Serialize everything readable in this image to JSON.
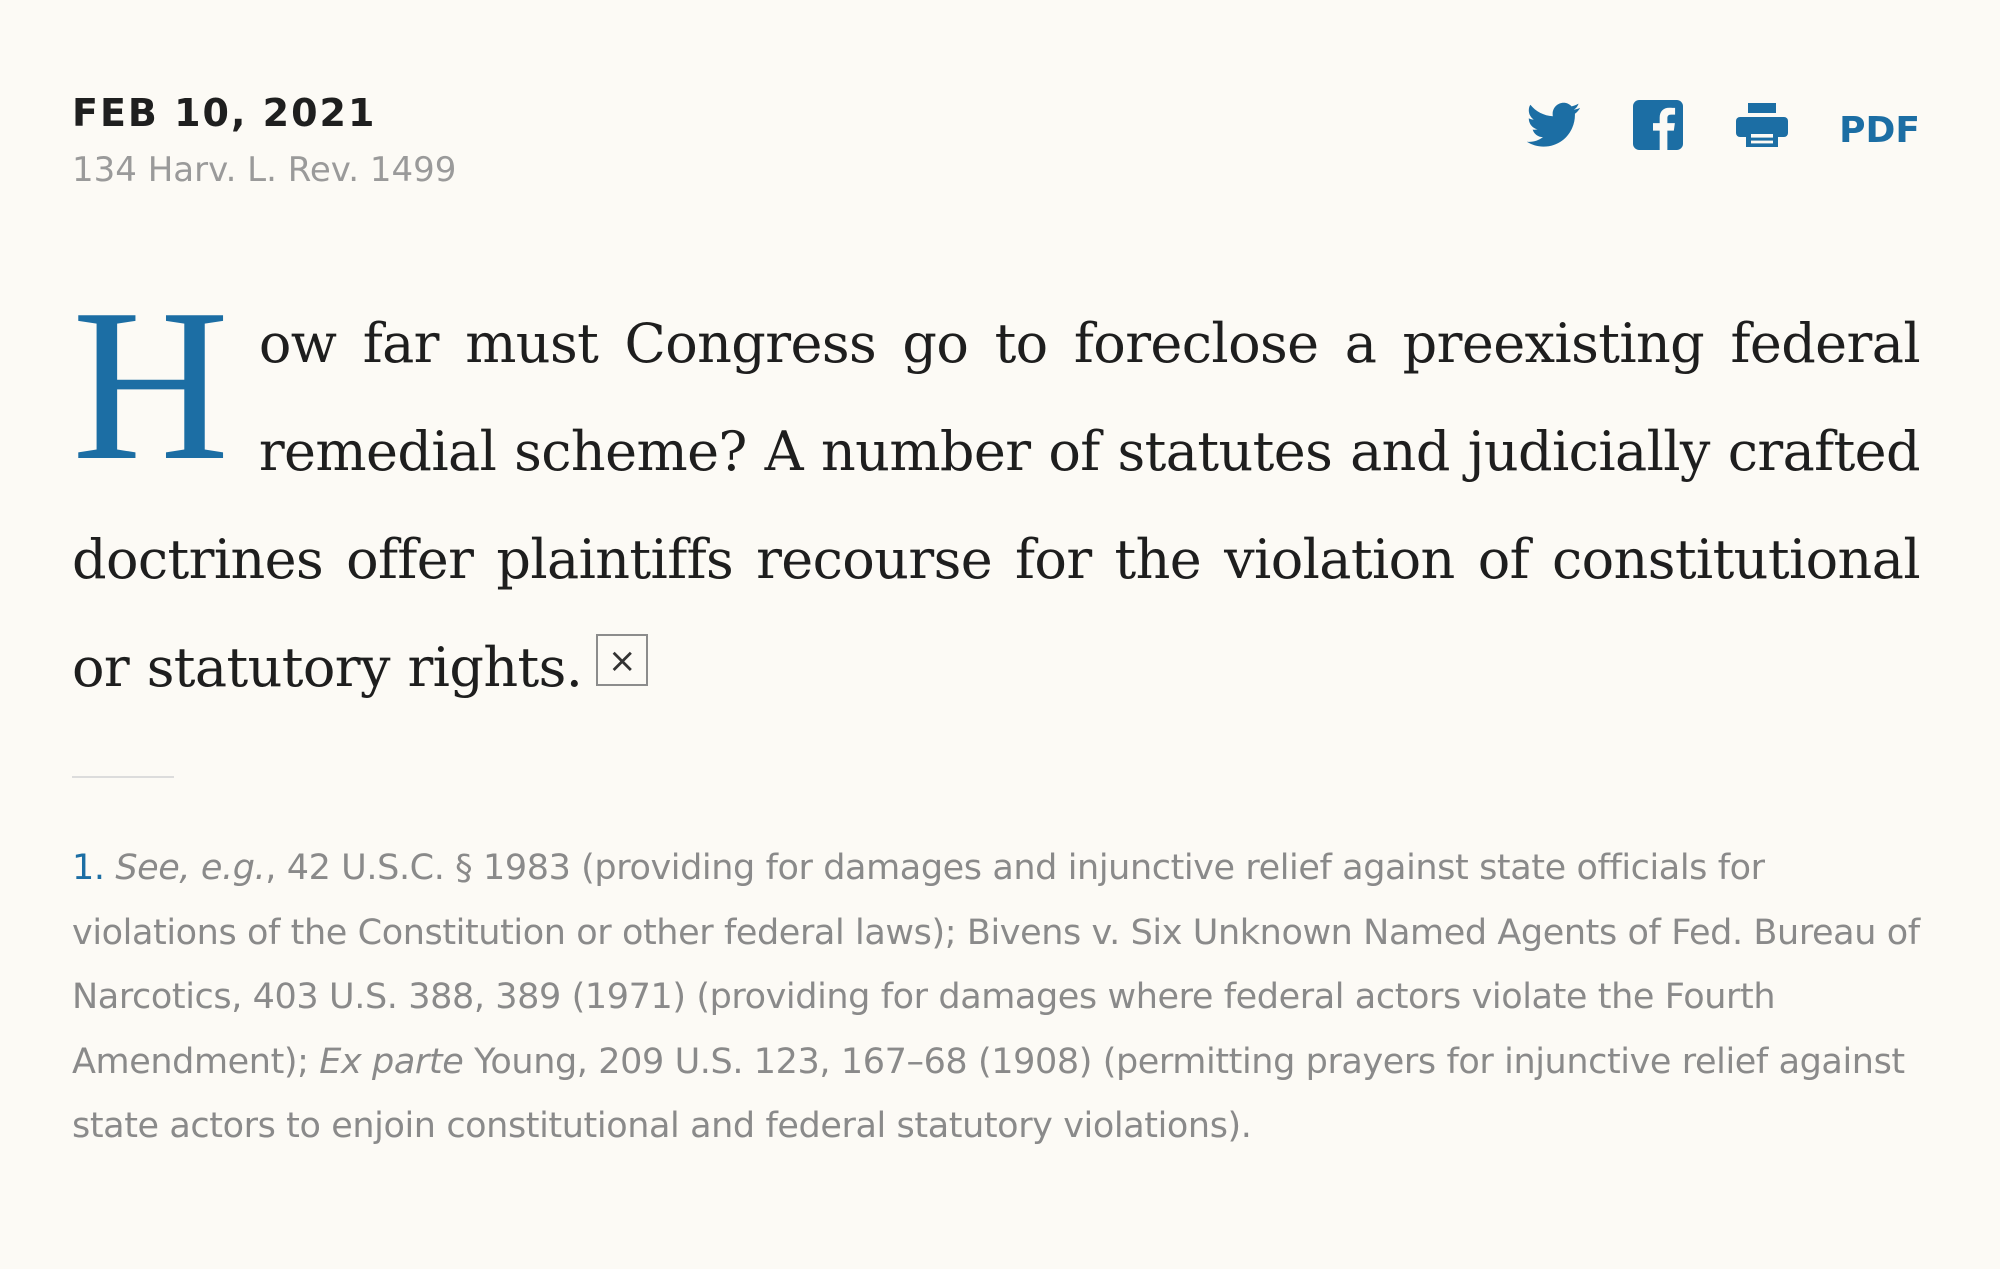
{
  "header": {
    "date": "FEB 10, 2021",
    "citation": "134 Harv. L. Rev. 1499"
  },
  "share": {
    "twitter_icon": "twitter-icon",
    "facebook_icon": "facebook-icon",
    "print_icon": "print-icon",
    "pdf_label": "PDF",
    "accent_color": "#1c6ea4"
  },
  "article": {
    "drop_cap": "H",
    "lead_text": "ow far must Congress go to foreclose a preexisting federal re­medial scheme? A number of statutes and judicially crafted doctrines offer plaintiffs recourse for the violation of constitutional or statutory rights.",
    "footnote_marker": "×"
  },
  "footnote": {
    "number": "1.",
    "part1_italic": "See, e.g.",
    "part2": ", 42 U.S.C. § 1983 (providing for damages and injunctive relief against state officials for violations of the Constitution or other federal laws); Bivens v. Six Unknown Named Agents of Fed. Bureau of Narcotics, 403 U.S. 388, 389 (1971) (providing for damages where federal ac­tors violate the Fourth Amendment); ",
    "part3_italic": "Ex parte",
    "part4": " Young, 209 U.S. 123, 167–68 (1908) (permitting prayers for injunctive relief against state actors to enjoin constitutional and federal statutory violations)."
  }
}
